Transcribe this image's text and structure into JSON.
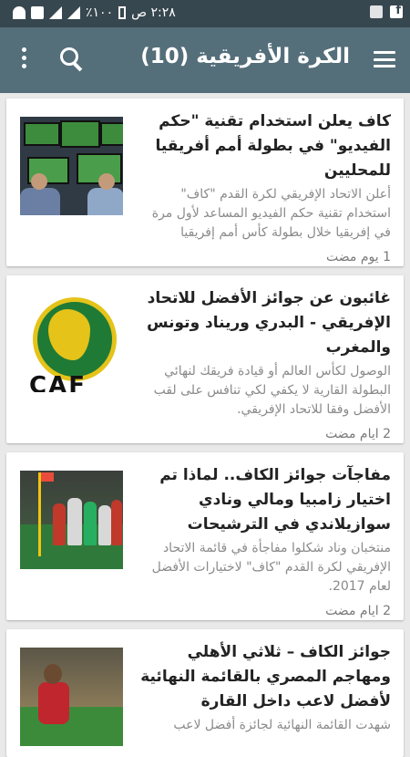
{
  "statusbar": {
    "time": "٢:٢٨ ص",
    "battery": "١٠٠٪"
  },
  "appbar": {
    "title": "الكرة الأفريقية (10)",
    "icons": [
      "menu-icon",
      "search-icon",
      "overflow-menu-icon"
    ]
  },
  "articles": [
    {
      "headline": "كاف يعلن استخدام تقنية \"حكم الفيديو\" في بطولة أمم أفريقيا للمحليين",
      "excerpt": "أعلن الاتحاد الإفريقي لكرة القدم \"كاف\" استخدام تقنية حكم الفيديو المساعد لأول مرة في إفريقيا خلال بطولة كأس أمم إفريقيا",
      "time": "1 يوم مضت",
      "thumb": "var-room"
    },
    {
      "headline": "غائبون عن جوائز الأفضل للاتحاد الإفريقي - البدري وريناد وتونس والمغرب",
      "excerpt": "الوصول لكأس العالم أو قيادة فريقك لنهائي البطولة القارية لا يكفي لكي تنافس على لقب الأفضل وفقا للاتحاد الإفريقي.",
      "time": "2 ايام مضت",
      "thumb": "caf-logo",
      "thumb_text": "CAF"
    },
    {
      "headline": "مفاجآت جوائز الكاف.. لماذا تم اختيار زامبيا ومالي ونادي سوازيلاندي في الترشيحات",
      "excerpt": "منتخبان وناد شكلوا مفاجأة في قائمة الاتحاد الإفريقي لكرة القدم \"كاف\" لاختيارات الأفضل لعام 2017.",
      "time": "2 ايام مضت",
      "thumb": "players-celebrating"
    },
    {
      "headline": "جوائز الكاف – ثلاثي الأهلي ومهاجم المصري بالقائمة النهائية لأفضل لاعب داخل القارة",
      "excerpt": "شهدت القائمة النهائية لجائزة أفضل لاعب",
      "time": "",
      "thumb": "player-red"
    }
  ]
}
